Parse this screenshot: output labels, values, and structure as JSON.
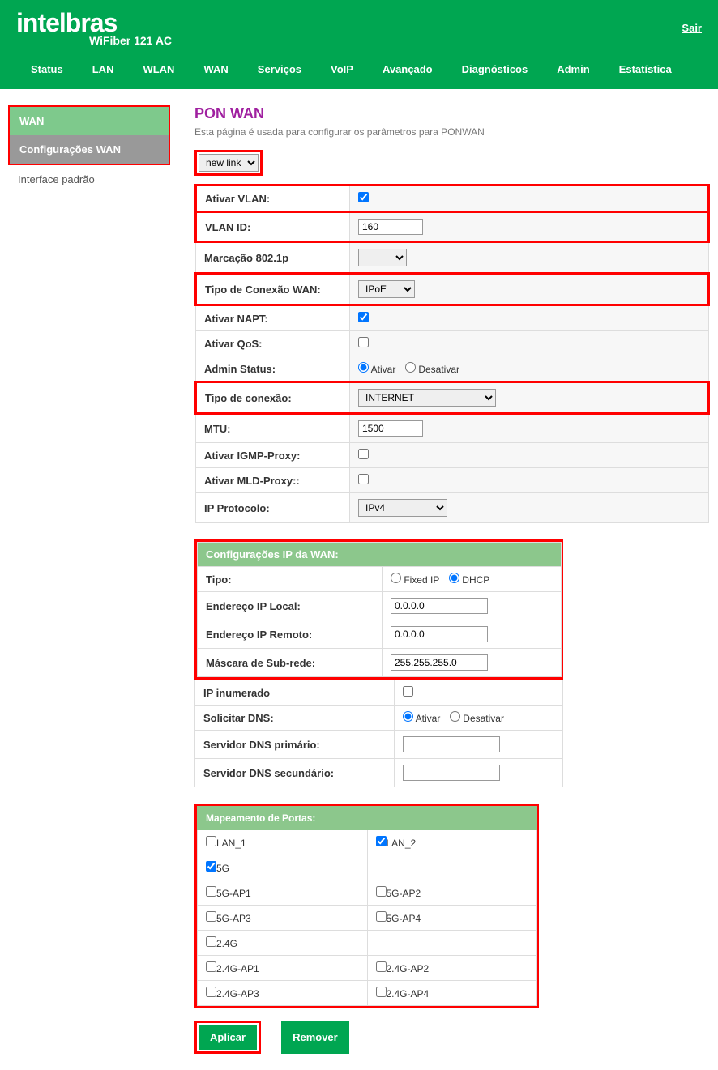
{
  "header": {
    "brand": "intelbras",
    "model": "WiFiber 121 AC",
    "exit": "Sair"
  },
  "nav": {
    "items": [
      "Status",
      "LAN",
      "WLAN",
      "WAN",
      "Serviços",
      "VoIP",
      "Avançado",
      "Diagnósticos",
      "Admin",
      "Estatística"
    ],
    "active": "WAN"
  },
  "sidebar": {
    "section": "WAN",
    "sub": "Configurações WAN",
    "other": "Interface padrão"
  },
  "page": {
    "title": "PON WAN",
    "desc": "Esta página é usada para configurar os parâmetros para PONWAN"
  },
  "form": {
    "link_select": "new link",
    "ativar_vlan_label": "Ativar VLAN:",
    "ativar_vlan_checked": true,
    "vlan_id_label": "VLAN ID:",
    "vlan_id_value": "160",
    "marcacao_label": "Marcação 802.1p",
    "marcacao_value": "",
    "tipo_wan_label": "Tipo de Conexão WAN:",
    "tipo_wan_value": "IPoE",
    "ativar_napt_label": "Ativar NAPT:",
    "ativar_napt_checked": true,
    "ativar_qos_label": "Ativar QoS:",
    "ativar_qos_checked": false,
    "admin_status_label": "Admin Status:",
    "admin_ativar": "Ativar",
    "admin_desativar": "Desativar",
    "tipo_conexao_label": "Tipo de conexão:",
    "tipo_conexao_value": "INTERNET",
    "mtu_label": "MTU:",
    "mtu_value": "1500",
    "igmp_label": "Ativar IGMP-Proxy:",
    "mld_label": "Ativar MLD-Proxy::",
    "ip_proto_label": "IP Protocolo:",
    "ip_proto_value": "IPv4"
  },
  "ipwan": {
    "header": "Configurações IP da WAN:",
    "tipo_label": "Tipo:",
    "fixed_ip": "Fixed IP",
    "dhcp": "DHCP",
    "local_ip_label": "Endereço IP Local:",
    "local_ip_value": "0.0.0.0",
    "remote_ip_label": "Endereço IP Remoto:",
    "remote_ip_value": "0.0.0.0",
    "mask_label": "Máscara de Sub-rede:",
    "mask_value": "255.255.255.0",
    "ip_inum_label": "IP inumerado",
    "dns_req_label": "Solicitar DNS:",
    "dns_ativar": "Ativar",
    "dns_desativar": "Desativar",
    "dns1_label": "Servidor DNS primário:",
    "dns2_label": "Servidor DNS secundário:"
  },
  "ports": {
    "header": "Mapeamento de Portas:",
    "rows": [
      {
        "left": "LAN_1",
        "left_checked": false,
        "right": "LAN_2",
        "right_checked": true
      },
      {
        "left": "5G",
        "left_checked": true,
        "right": "",
        "right_checked": false
      },
      {
        "left": "5G-AP1",
        "left_checked": false,
        "right": "5G-AP2",
        "right_checked": false
      },
      {
        "left": "5G-AP3",
        "left_checked": false,
        "right": "5G-AP4",
        "right_checked": false
      },
      {
        "left": "2.4G",
        "left_checked": false,
        "right": "",
        "right_checked": false
      },
      {
        "left": "2.4G-AP1",
        "left_checked": false,
        "right": "2.4G-AP2",
        "right_checked": false
      },
      {
        "left": "2.4G-AP3",
        "left_checked": false,
        "right": "2.4G-AP4",
        "right_checked": false
      }
    ]
  },
  "buttons": {
    "apply": "Aplicar",
    "remove": "Remover"
  }
}
